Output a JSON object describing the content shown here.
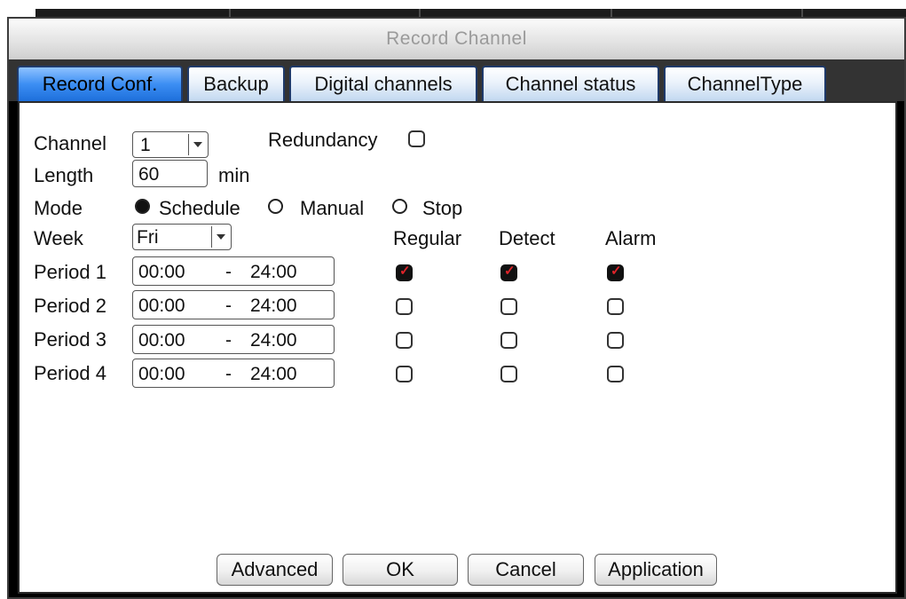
{
  "window": {
    "title": "Record Channel"
  },
  "tabs": [
    {
      "label": "Record Conf.",
      "active": true
    },
    {
      "label": "Backup",
      "active": false
    },
    {
      "label": "Digital channels",
      "active": false
    },
    {
      "label": "Channel status",
      "active": false
    },
    {
      "label": "ChannelType",
      "active": false
    }
  ],
  "form": {
    "channel_label": "Channel",
    "channel_value": "1",
    "redundancy_label": "Redundancy",
    "redundancy_checked": false,
    "length_label": "Length",
    "length_value": "60",
    "length_unit": "min",
    "mode_label": "Mode",
    "mode_options": [
      {
        "label": "Schedule",
        "selected": true
      },
      {
        "label": "Manual",
        "selected": false
      },
      {
        "label": "Stop",
        "selected": false
      }
    ],
    "week_label": "Week",
    "week_value": "Fri",
    "columns": [
      "Regular",
      "Detect",
      "Alarm"
    ],
    "periods": [
      {
        "label": "Period 1",
        "start": "00:00",
        "sep": "-",
        "end": "24:00",
        "regular": true,
        "detect": true,
        "alarm": true
      },
      {
        "label": "Period 2",
        "start": "00:00",
        "sep": "-",
        "end": "24:00",
        "regular": false,
        "detect": false,
        "alarm": false
      },
      {
        "label": "Period 3",
        "start": "00:00",
        "sep": "-",
        "end": "24:00",
        "regular": false,
        "detect": false,
        "alarm": false
      },
      {
        "label": "Period 4",
        "start": "00:00",
        "sep": "-",
        "end": "24:00",
        "regular": false,
        "detect": false,
        "alarm": false
      }
    ]
  },
  "buttons": {
    "advanced": "Advanced",
    "ok": "OK",
    "cancel": "Cancel",
    "application": "Application"
  },
  "colors": {
    "active_tab": "#3c8ef3",
    "check_mark": "#e0242a"
  }
}
